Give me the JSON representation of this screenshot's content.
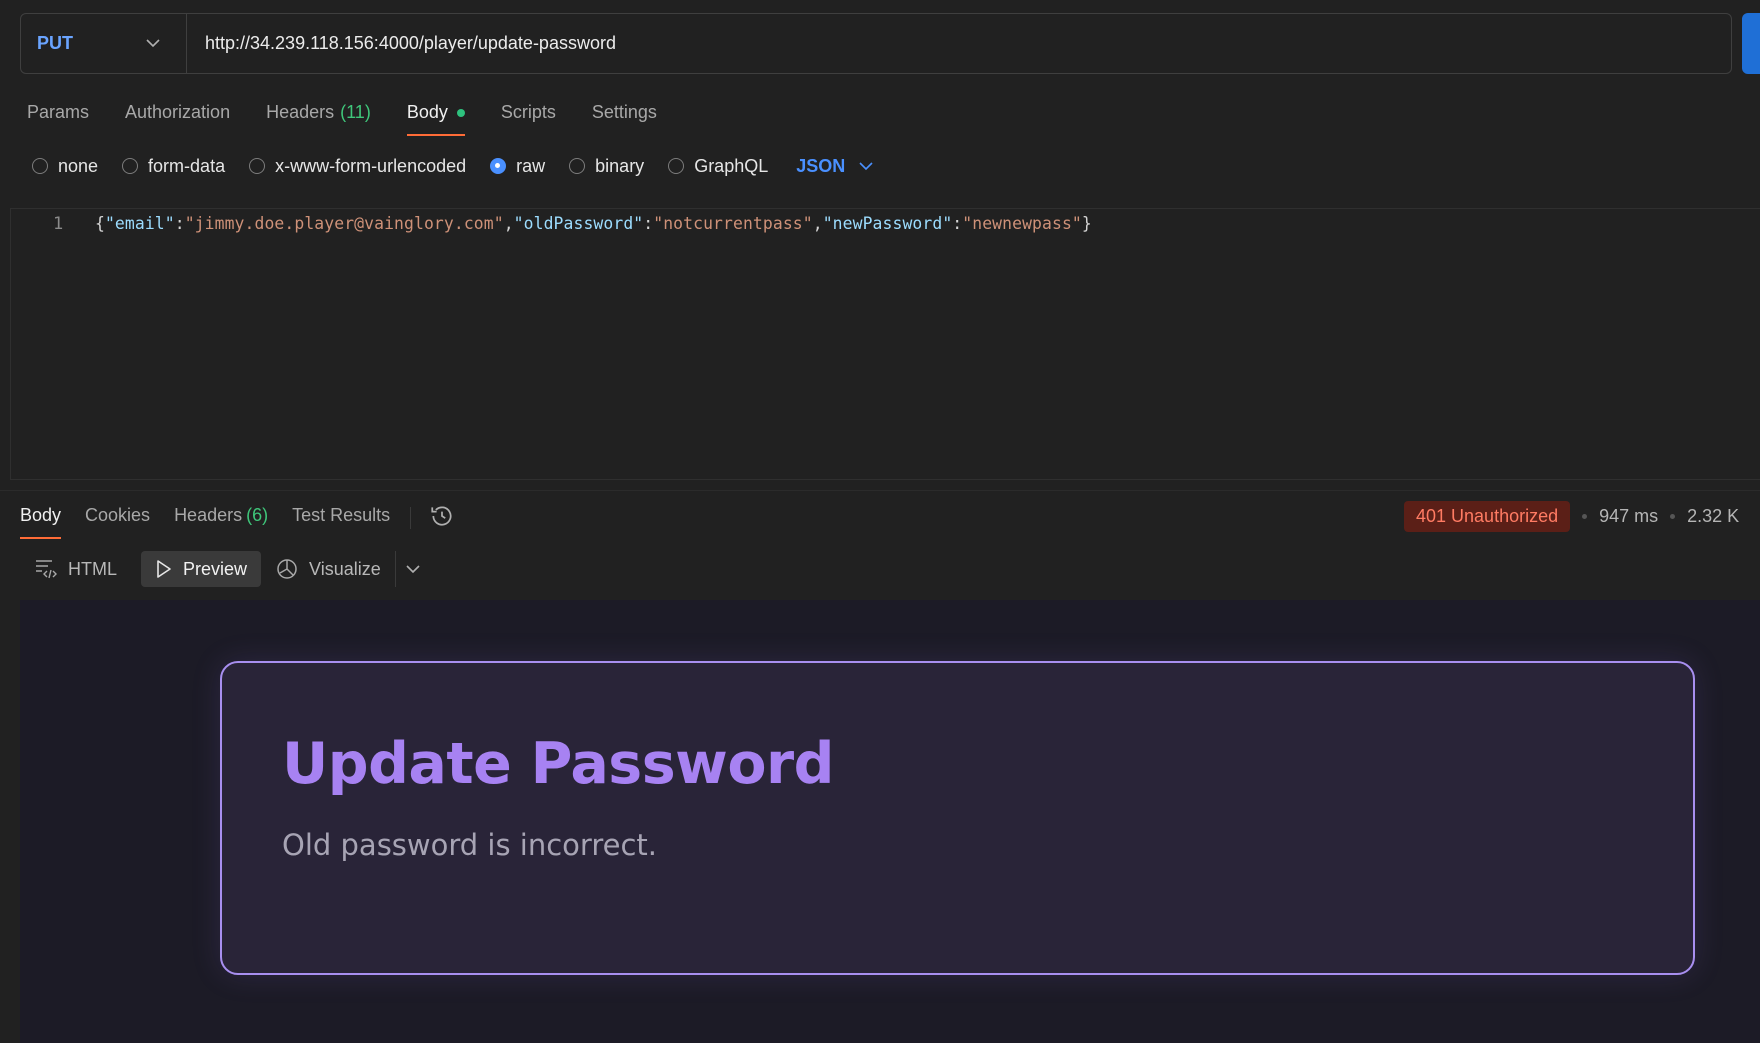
{
  "request": {
    "method": "PUT",
    "url": "http://34.239.118.156:4000/player/update-password"
  },
  "request_tabs": {
    "params": "Params",
    "authorization": "Authorization",
    "headers": "Headers",
    "headers_count": "(11)",
    "body": "Body",
    "scripts": "Scripts",
    "settings": "Settings"
  },
  "body_modes": {
    "none": "none",
    "form_data": "form-data",
    "urlencoded": "x-www-form-urlencoded",
    "raw": "raw",
    "binary": "binary",
    "graphql": "GraphQL",
    "format": "JSON",
    "selected": "raw"
  },
  "editor": {
    "line_number": "1",
    "tokens": {
      "open": "{",
      "k_email": "\"email\"",
      "colon": ":",
      "v_email": "\"jimmy.doe.player@vainglory.com\"",
      "comma": ",",
      "k_old": "\"oldPassword\"",
      "v_old": "\"notcurrentpass\"",
      "k_new": "\"newPassword\"",
      "v_new": "\"newnewpass\"",
      "close": "}"
    }
  },
  "response_tabs": {
    "body": "Body",
    "cookies": "Cookies",
    "headers": "Headers",
    "headers_count": "(6)",
    "test_results": "Test Results"
  },
  "response_meta": {
    "status": "401 Unauthorized",
    "time": "947 ms",
    "size": "2.32 K"
  },
  "preview_toolbar": {
    "html": "HTML",
    "preview": "Preview",
    "visualize": "Visualize"
  },
  "preview_page": {
    "title": "Update Password",
    "message": "Old password is incorrect."
  },
  "colors": {
    "accent_tab": "#ff6c37",
    "method": "#6aa4ff",
    "status_error_bg": "#5b1f17",
    "status_error_text": "#ff7b63",
    "card_border": "#a88ff0",
    "card_title": "#a782f2"
  }
}
